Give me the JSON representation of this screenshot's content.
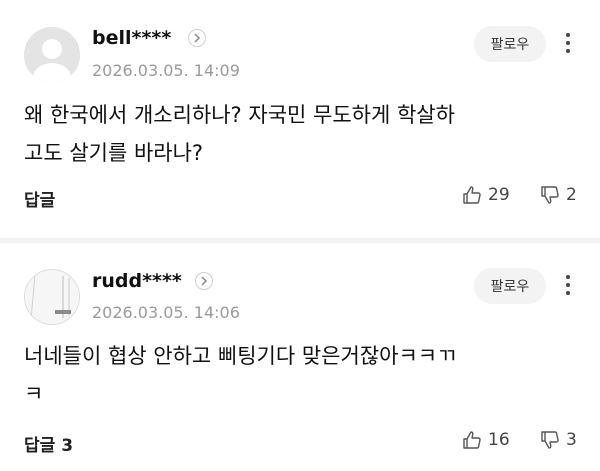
{
  "comments": [
    {
      "username": "bell****",
      "timestamp": "2026.03.05. 14:09",
      "follow_label": "팔로우",
      "text_line1": "왜 한국에서 개소리하나? 자국민 무도하게 학살하",
      "text_line2": "고도 살기를 바라나?",
      "reply_label": "답글",
      "likes": "29",
      "dislikes": "2",
      "icons": [
        "avatar-placeholder",
        "chevron-right-icon",
        "more-vert-icon",
        "thumbs-up-icon",
        "thumbs-down-icon"
      ]
    },
    {
      "username": "rudd****",
      "timestamp": "2026.03.05. 14:06",
      "follow_label": "팔로우",
      "text_line1": "너네들이 협상 안하고 삐팅기다 맞은거잖아ㅋㅋㄲ",
      "text_line2": "ㅋ",
      "reply_label": "답글 3",
      "likes": "16",
      "dislikes": "3",
      "icons": [
        "avatar-photo",
        "chevron-right-icon",
        "more-vert-icon",
        "thumbs-up-icon",
        "thumbs-down-icon"
      ]
    }
  ]
}
